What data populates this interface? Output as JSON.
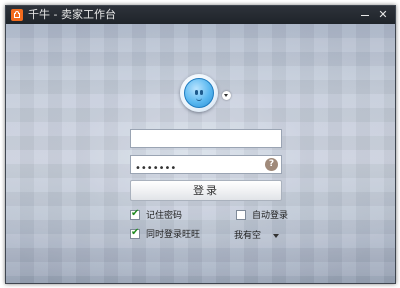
{
  "window": {
    "title": "千牛 - 卖家工作台",
    "minimize_label": "",
    "close_label": "✕"
  },
  "login": {
    "account_value": "",
    "password_value": "•••••••",
    "help_label": "?",
    "login_button_label": "登录",
    "remember_password": {
      "label": "记住密码",
      "checked": true
    },
    "auto_login": {
      "label": "自动登录",
      "checked": false
    },
    "wangwang_login": {
      "label": "同时登录旺旺",
      "checked": true
    },
    "status_value": "我有空"
  },
  "colors": {
    "titlebar": "#252a31",
    "app_icon": "#f26b1d",
    "check_mark": "#1f8a1f"
  },
  "icons": [
    "qianniu-logo-icon",
    "minimize-icon",
    "close-icon",
    "avatar-icon",
    "status-dropdown-icon",
    "help-icon",
    "checkbox-icon",
    "chevron-down-icon"
  ]
}
